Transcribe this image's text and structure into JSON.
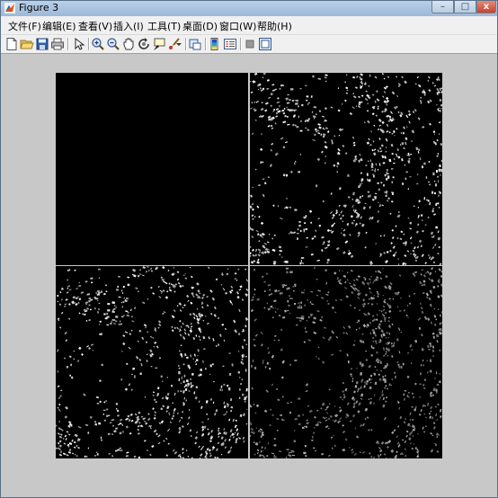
{
  "window": {
    "title": "Figure 3",
    "controls": {
      "minimize": "–",
      "maximize": "□",
      "close": "x"
    }
  },
  "menubar": {
    "items": [
      {
        "label": "文件(F)"
      },
      {
        "label": "编辑(E)"
      },
      {
        "label": "查看(V)"
      },
      {
        "label": "插入(I)"
      },
      {
        "label": "工具(T)"
      },
      {
        "label": "桌面(D)"
      },
      {
        "label": "窗口(W)"
      },
      {
        "label": "帮助(H)"
      }
    ]
  },
  "toolbar": {
    "icons": [
      "new-figure-icon",
      "open-file-icon",
      "save-icon",
      "print-icon",
      "edit-plot-icon",
      "zoom-in-icon",
      "zoom-out-icon",
      "pan-icon",
      "rotate-3d-icon",
      "data-cursor-icon",
      "brush-icon",
      "brush-dropdown-icon",
      "link-plot-icon",
      "colorbar-icon",
      "legend-icon",
      "hide-plot-tools-icon",
      "show-plot-tools-icon"
    ]
  },
  "figure": {
    "background_color": "#c8c8c8",
    "panels": [
      {
        "name": "top-left",
        "content": "black"
      },
      {
        "name": "top-right",
        "content": "texture"
      },
      {
        "name": "bottom-left",
        "content": "texture"
      },
      {
        "name": "bottom-right",
        "content": "texture-dim"
      }
    ]
  }
}
